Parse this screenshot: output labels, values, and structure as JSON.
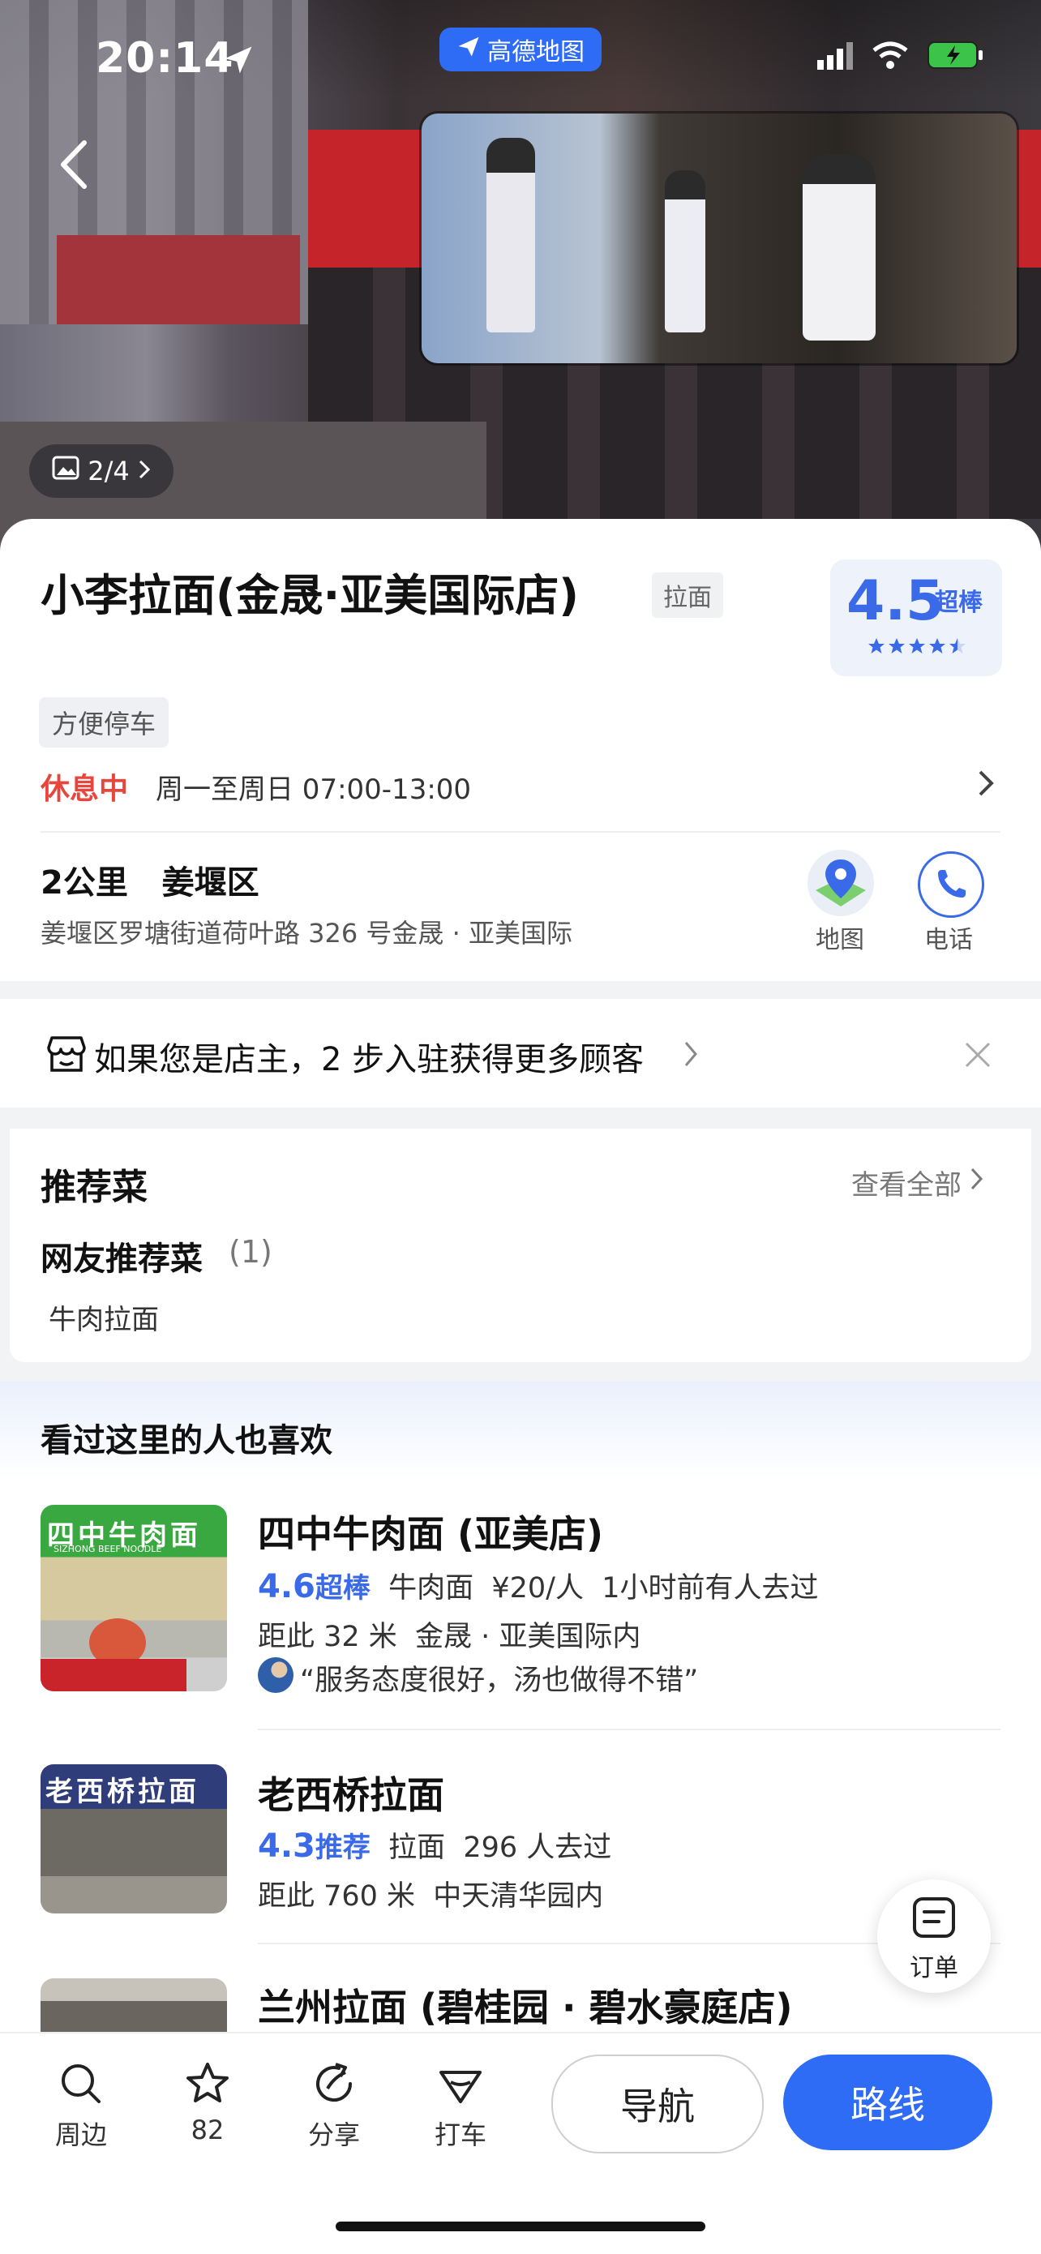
{
  "status_bar": {
    "time": "20:14",
    "app_pill": "高德地图"
  },
  "hero": {
    "photo_count": "2/4"
  },
  "poi": {
    "name": "小李拉面(金晟·亚美国际店)",
    "category_tag": "拉面",
    "rating": "4.5",
    "rating_word": "超棒",
    "rating_stars": 4.5,
    "feature_tag": "方便停车",
    "open_status": "休息中",
    "hours": "周一至周日 07:00-13:00",
    "distance_area": "2公里   姜堰区",
    "address": "姜堰区罗塘街道荷叶路 326 号金晟 · 亚美国际",
    "actions": {
      "map_label": "地图",
      "phone_label": "电话"
    }
  },
  "owner_banner": {
    "text": "如果您是店主，2 步入驻获得更多顾客"
  },
  "recommended": {
    "title": "推荐菜",
    "view_all": "查看全部",
    "sub_title": "网友推荐菜",
    "sub_count": "(1)",
    "dishes": [
      "牛肉拉面"
    ]
  },
  "also_liked": {
    "title": "看过这里的人也喜欢",
    "items": [
      {
        "name": "四中牛肉面 (亚美店)",
        "score": "4.6",
        "score_word": "超棒",
        "meta": "牛肉面  ¥20/人  1小时前有人去过",
        "location": "距此 32 米  金晟 · 亚美国际内",
        "review": "“服务态度很好，汤也做得不错”",
        "thumb_sign": "四中牛肉面",
        "thumb_sign_en": "SIZHONG BEEF NOODLE"
      },
      {
        "name": "老西桥拉面",
        "score": "4.3",
        "score_word": "推荐",
        "meta": "拉面  296 人去过",
        "location": "距此 760 米  中天清华园内",
        "thumb_sign": "老西桥拉面"
      },
      {
        "name": "兰州拉面 (碧桂园 · 碧水豪庭店)"
      }
    ]
  },
  "order_fab": {
    "label": "订单"
  },
  "bottom_bar": {
    "nearby": "周边",
    "favorite_count": "82",
    "share": "分享",
    "taxi": "打车",
    "navigate": "导航",
    "route": "路线"
  },
  "colors": {
    "accent": "#2f6cf5",
    "rating_blue": "#3b6ae8",
    "closed_red": "#e8453c"
  }
}
